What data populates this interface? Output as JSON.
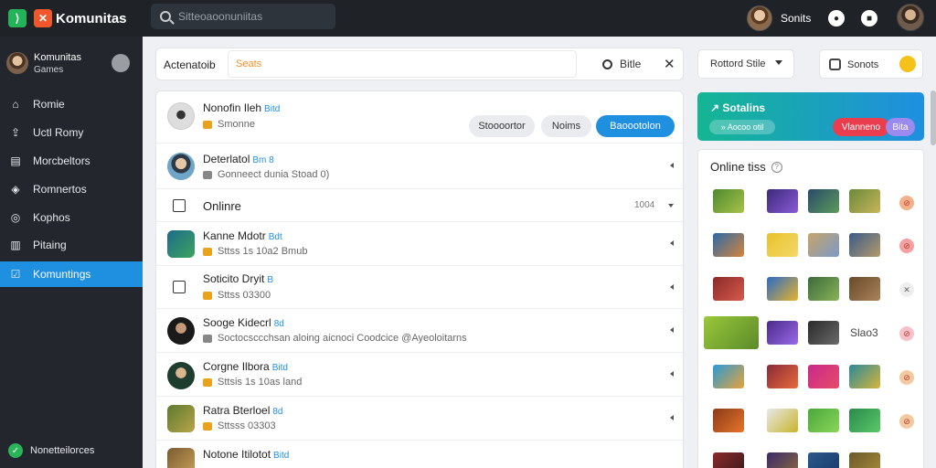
{
  "app": {
    "brand": "Komunitas"
  },
  "topbar": {
    "search_placeholder": "Sitteoaoonuniitas",
    "user_name": "Sonits",
    "chat_icon": "chat-icon",
    "bag_icon": "bag-icon"
  },
  "sidebar": {
    "profile": {
      "name": "Komunitas",
      "sub": "Games"
    },
    "items": [
      {
        "label": "Romie",
        "icon": "home-icon"
      },
      {
        "label": "Uctl Romy",
        "icon": "upload-icon"
      },
      {
        "label": "Morcbeltors",
        "icon": "board-icon"
      },
      {
        "label": "Romnertos",
        "icon": "shield-icon"
      },
      {
        "label": "Kophos",
        "icon": "target-icon"
      },
      {
        "label": "Pitaing",
        "icon": "chart-icon"
      },
      {
        "label": "Komuntings",
        "icon": "check-box-icon"
      }
    ],
    "status": "Nonetteilorces"
  },
  "filter": {
    "label": "Actenatoib",
    "input_value": "Seats",
    "find_label": "Bitle",
    "sort_label": "Rottord Stile",
    "settings_label": "Sonots"
  },
  "feed": {
    "top": {
      "name": "Nonofin Ileh",
      "tag": "Bitd",
      "meta": "Smonne",
      "chip1": "Stoooortor",
      "chip2": "Noims",
      "chip3": "Baoootolon"
    },
    "rows": [
      {
        "name": "Deterlatol",
        "tag": "Bm 8",
        "meta": "Gonneect dunia Stoad 0)"
      },
      {
        "name": "Onlinre",
        "tag": "",
        "meta": "",
        "count": "1004"
      },
      {
        "name": "Kanne Mdotr",
        "tag": "Bdt",
        "meta": "Sttss 1s 10a2 Bmub"
      },
      {
        "name": "Soticito Dryit",
        "tag": "B",
        "meta": "Sttss 03300"
      },
      {
        "name": "Sooge Kidecrl",
        "tag": "8d",
        "meta": "Soctocsccchsan aloing aicnoci Coodcice @Ayeoloitarns"
      },
      {
        "name": "Corgne Ilbora",
        "tag": "Bitd",
        "meta": "Sttsis 1s 10as land"
      },
      {
        "name": "Ratra Bterloel",
        "tag": "8d",
        "meta": "Sttsss 03303"
      },
      {
        "name": "Notone Itilotot",
        "tag": "Bitd",
        "meta": ""
      }
    ]
  },
  "right": {
    "hero": {
      "title": "Sotalins",
      "pill": "» Aocoo otil",
      "btn1": "Vlanneno",
      "btn2": "Bita"
    },
    "online": {
      "title": "Online tiss",
      "extra_label": "Slao3"
    }
  },
  "colors": {
    "accent": "#1f8fe0",
    "sidebar_bg": "#23272d",
    "topbar_bg": "#1f2328"
  }
}
